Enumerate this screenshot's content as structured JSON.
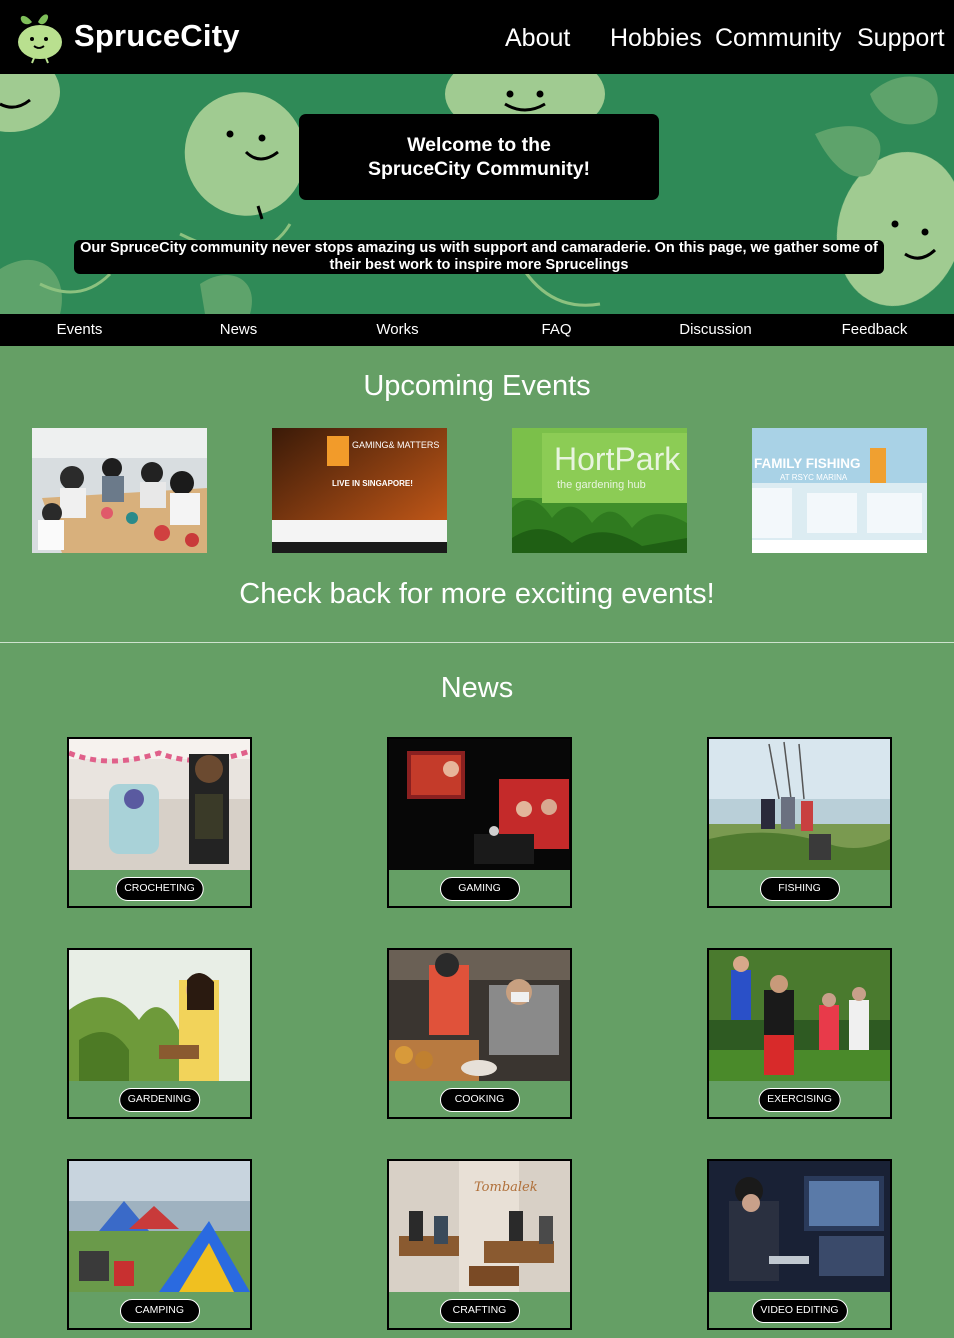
{
  "header": {
    "brand": "SpruceCity",
    "nav": [
      "About",
      "Hobbies",
      "Community",
      "Support"
    ]
  },
  "hero": {
    "welcome_line1": "Welcome to the",
    "welcome_line2": "SpruceCity Community!",
    "intro": "Our SpruceCity community never stops amazing us with support and camaraderie. On this page, we gather some of their best work to inspire more Sprucelings"
  },
  "subnav": [
    "Events",
    "News",
    "Works",
    "FAQ",
    "Discussion",
    "Feedback"
  ],
  "events": {
    "title": "Upcoming Events",
    "footer": "Check back for more exciting events!",
    "images": [
      {
        "alt": "crochet workshop"
      },
      {
        "alt": "gaming matters"
      },
      {
        "alt": "hortpark"
      },
      {
        "alt": "family fishing"
      }
    ],
    "gaming_text": "GAMING& MATTERS",
    "gaming_sub": "LIVE IN SINGAPORE!",
    "hortpark_text": "HortPark",
    "hortpark_sub": "the gardening hub",
    "fishing_text": "FAMILY FISHING",
    "fishing_sub": "AT RSYC MARINA"
  },
  "news": {
    "title": "News",
    "cards": [
      "CROCHETING",
      "GAMING",
      "FISHING",
      "GARDENING",
      "COOKING",
      "EXERCISING",
      "CAMPING",
      "CRAFTING",
      "VIDEO EDITING"
    ]
  },
  "colors": {
    "page_bg": "#659f65",
    "hero_bg": "#2f8a57",
    "bar": "#000000"
  }
}
